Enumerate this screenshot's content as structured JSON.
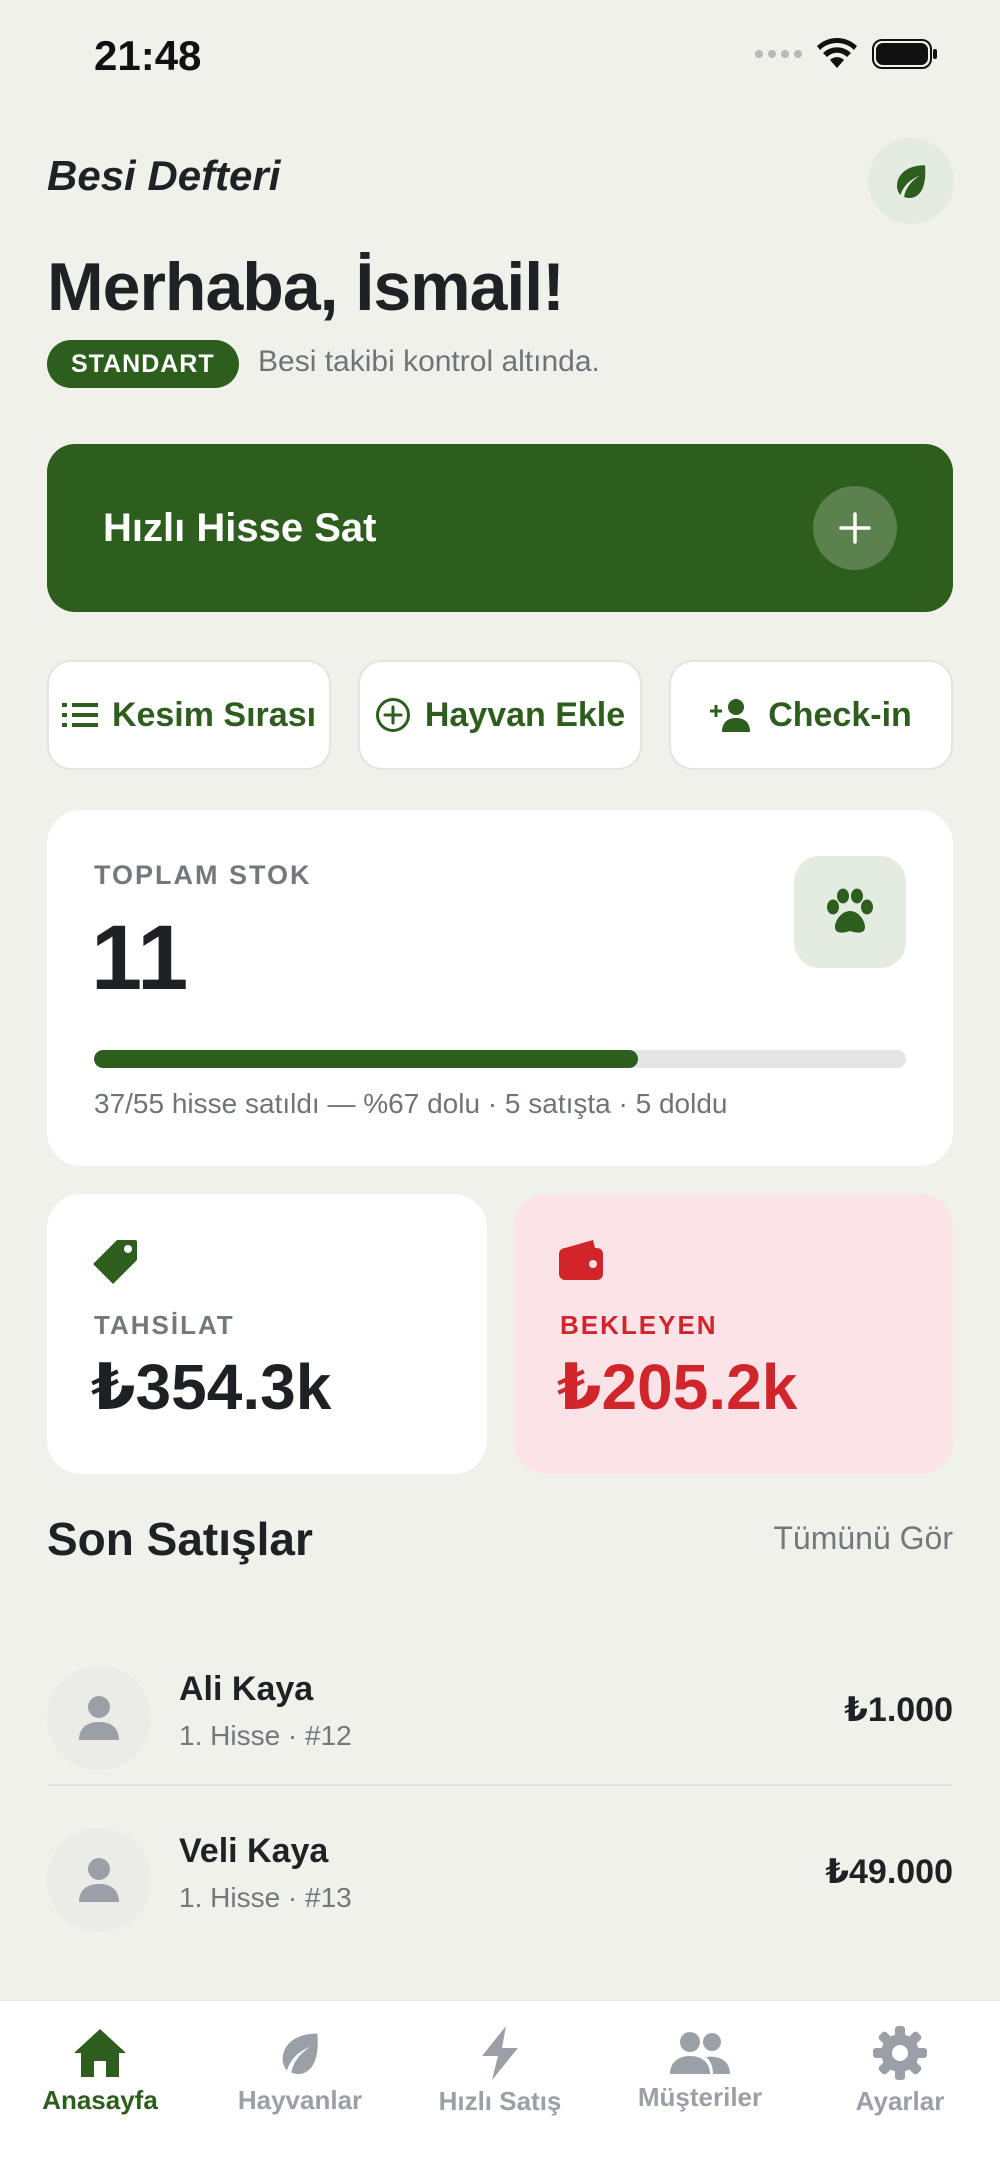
{
  "status_bar": {
    "time": "21:48"
  },
  "header": {
    "app_title": "Besi Defteri",
    "greeting": "Merhaba, İsmail!",
    "plan_badge": "STANDART",
    "subtitle": "Besi takibi kontrol altında."
  },
  "hero_action": {
    "label": "Hızlı Hisse Sat",
    "icon": "plus-icon"
  },
  "quick_actions": [
    {
      "label": "Kesim Sırası",
      "icon": "list-icon"
    },
    {
      "label": "Hayvan Ekle",
      "icon": "plus-circle-icon"
    },
    {
      "label": "Check-in",
      "icon": "person-add-icon"
    }
  ],
  "stock": {
    "label": "TOPLAM STOK",
    "value": "11",
    "progress_percent": 67,
    "meta": "37/55 hisse satıldı — %67 dolu · 5 satışta · 5 doldu"
  },
  "collected": {
    "label": "TAHSİLAT",
    "value": "₺354.3k",
    "color": "#2d5e1e"
  },
  "pending": {
    "label": "BEKLEYEN",
    "value": "₺205.2k",
    "color": "#d0262b"
  },
  "recent_sales": {
    "title": "Son Satışlar",
    "see_all": "Tümünü Gör",
    "items": [
      {
        "name": "Ali Kaya",
        "detail": "1. Hisse · #12",
        "amount": "₺1.000"
      },
      {
        "name": "Veli Kaya",
        "detail": "1. Hisse · #13",
        "amount": "₺49.000"
      }
    ]
  },
  "tabs": [
    {
      "label": "Anasayfa",
      "icon": "home-icon",
      "active": true
    },
    {
      "label": "Hayvanlar",
      "icon": "leaf-icon",
      "active": false
    },
    {
      "label": "Hızlı Satış",
      "icon": "bolt-icon",
      "active": false
    },
    {
      "label": "Müşteriler",
      "icon": "people-icon",
      "active": false
    },
    {
      "label": "Ayarlar",
      "icon": "gear-icon",
      "active": false
    }
  ],
  "colors": {
    "brand": "#2d5e1e",
    "background": "#f0f1eb"
  }
}
